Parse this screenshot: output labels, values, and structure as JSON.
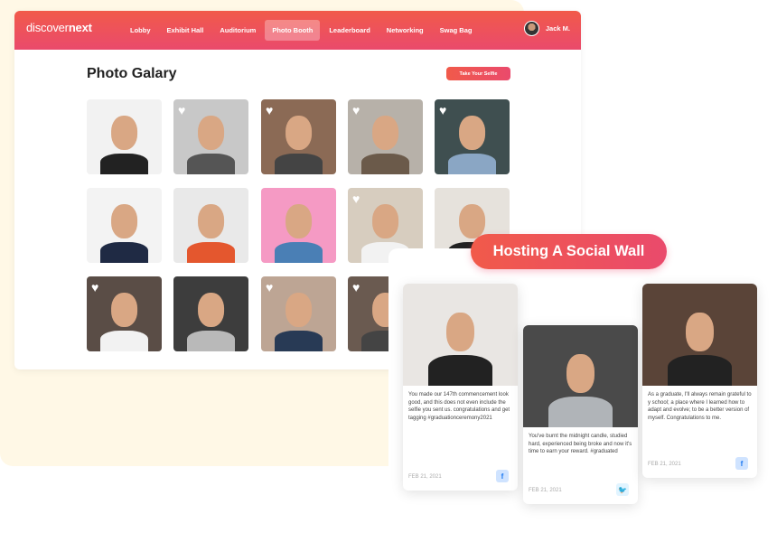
{
  "brand": {
    "name_light": "discover",
    "name_bold": "next"
  },
  "nav": {
    "items": [
      "Lobby",
      "Exhibit Hall",
      "Auditorium",
      "Photo Booth",
      "Leaderboard",
      "Networking",
      "Swag Bag"
    ],
    "active": "Photo Booth"
  },
  "user": {
    "name": "Jack M."
  },
  "gallery": {
    "title": "Photo Galary",
    "button": "Take Your Selfie",
    "photos": [
      {
        "bg": "#f2f2f2",
        "body": "#222",
        "liked": false
      },
      {
        "bg": "#c8c8c8",
        "body": "#555",
        "liked": true
      },
      {
        "bg": "#8b6a55",
        "body": "#444",
        "liked": true
      },
      {
        "bg": "#b7b1a9",
        "body": "#6b5a4a",
        "liked": true
      },
      {
        "bg": "#3f4f50",
        "body": "#8aa6c4",
        "liked": true
      },
      {
        "bg": "#f3f3f3",
        "body": "#1f2a44",
        "liked": false
      },
      {
        "bg": "#e9e9e9",
        "body": "#e4572e",
        "liked": false
      },
      {
        "bg": "#f59ac4",
        "body": "#4a7fb5",
        "liked": false
      },
      {
        "bg": "#d7cdbf",
        "body": "#f2f2f2",
        "liked": true
      },
      {
        "bg": "#e6e2dc",
        "body": "#222",
        "liked": false
      },
      {
        "bg": "#5a4d46",
        "body": "#f2f2f2",
        "liked": true
      },
      {
        "bg": "#3d3d3d",
        "body": "#b9b9b9",
        "liked": false
      },
      {
        "bg": "#bda594",
        "body": "#283a55",
        "liked": true
      },
      {
        "bg": "#6a5a50",
        "body": "#444",
        "liked": true
      },
      {
        "bg": "#eee",
        "body": "#ccc",
        "liked": false
      }
    ]
  },
  "social_wall": {
    "title": "Hosting A Social Wall",
    "posts": [
      {
        "text": "You made our 147th  commencement look good, and this does not even include the selfie you sent us. congratulations and get tagging #graduationceremony2021",
        "date": "FEB 21, 2021",
        "network": "facebook",
        "icon": "f"
      },
      {
        "text": "You've burnt the midnight candle, studied hard, experienced being broke and now it's time to earn your reward. #graduated",
        "date": "FEB 21, 2021",
        "network": "twitter",
        "icon": "🐦"
      },
      {
        "text": "As a graduate, I'll always remain grateful to y school; a place where I learned how to adapt and evolve; to be a better version of myself. Congratulations to me.",
        "date": "FEB 21, 2021",
        "network": "facebook",
        "icon": "f"
      }
    ]
  },
  "colors": {
    "accent": "#ec5060",
    "cream": "#fff8e6"
  }
}
